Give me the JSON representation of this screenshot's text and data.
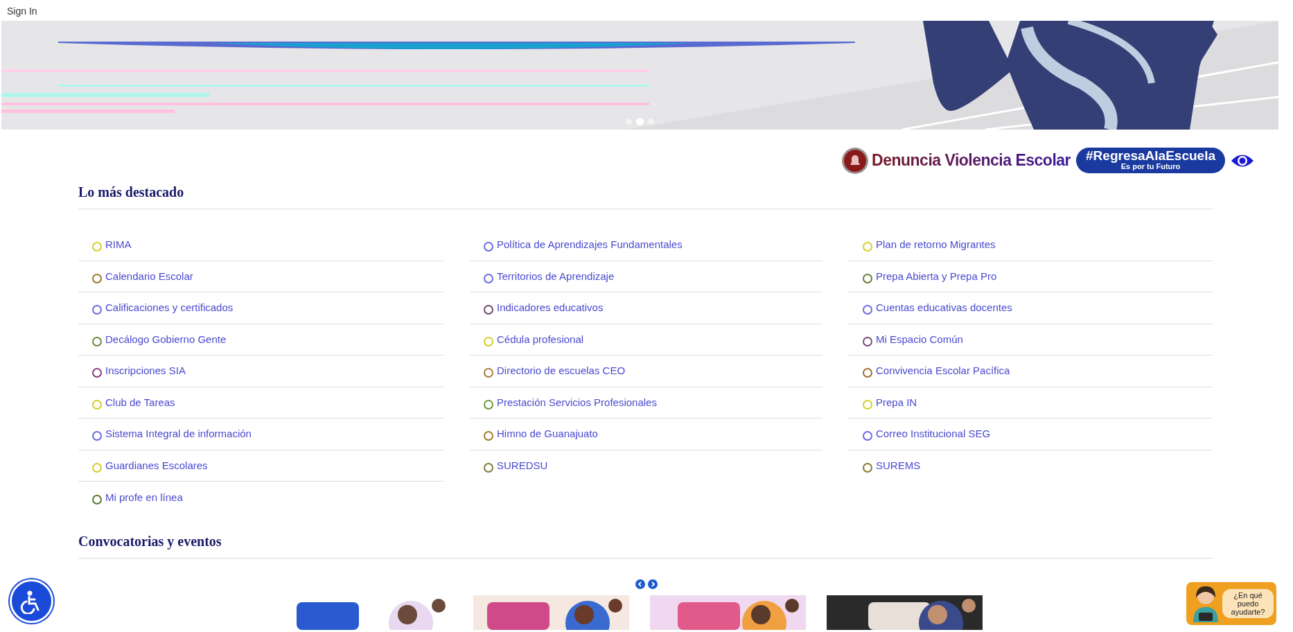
{
  "header": {
    "sign_in": "Sign In"
  },
  "banner": {
    "kind": "picture",
    "dots": [
      {
        "selected": false
      },
      {
        "selected": true
      },
      {
        "selected": false
      }
    ]
  },
  "quick_links": [
    {
      "kind": "alert",
      "label": "Denuncia Violencia Escolar"
    },
    {
      "kind": "pill",
      "label": "#RegresaAlaEscuela",
      "sublabel": "Es por tu Futuro"
    }
  ],
  "highlights": {
    "title": "Lo más destacado",
    "columns": [
      [
        {
          "label": "RIMA",
          "color": "#d4cf2a"
        },
        {
          "label": "Calendario Escolar",
          "color": "#9a7a2a"
        },
        {
          "label": "Calificaciones y certificados",
          "color": "#6a6ae0"
        },
        {
          "label": "Decálogo Gobierno Gente",
          "color": "#6a8a3a"
        },
        {
          "label": "Inscripciones SIA",
          "color": "#8a3a7a"
        },
        {
          "label": "Club de Tareas",
          "color": "#d4cf2a"
        },
        {
          "label": "Sistema Integral de información",
          "color": "#6a6ae0"
        },
        {
          "label": "Guardianes Escolares",
          "color": "#d4cf2a"
        },
        {
          "label": "Mi profe en línea",
          "color": "#5a7a2a"
        }
      ],
      [
        {
          "label": "Política de Aprendizajes Fundamentales",
          "color": "#6a6ae0"
        },
        {
          "label": "Territorios de Aprendizaje",
          "color": "#6a6ae0"
        },
        {
          "label": "Indicadores educativos",
          "color": "#6a4a6a"
        },
        {
          "label": "Cédula profesional",
          "color": "#d4cf2a"
        },
        {
          "label": "Directorio de escuelas CEO",
          "color": "#b07a3a"
        },
        {
          "label": "Prestación Servicios Profesionales",
          "color": "#6a9a3a"
        },
        {
          "label": "Himno de Guanajuato",
          "color": "#a07a2a"
        },
        {
          "label": "SUREDSU",
          "color": "#7a7a3a"
        }
      ],
      [
        {
          "label": "Plan de retorno Migrantes",
          "color": "#d4cf2a"
        },
        {
          "label": "Prepa Abierta y Prepa Pro",
          "color": "#6a7a3a"
        },
        {
          "label": "Cuentas educativas docentes",
          "color": "#6a6ae0"
        },
        {
          "label": "Mi Espacio Común",
          "color": "#7a4a7a"
        },
        {
          "label": "Convivencia Escolar Pacífica",
          "color": "#a0702a"
        },
        {
          "label": "Prepa IN",
          "color": "#d4cf2a"
        },
        {
          "label": "Correo Institucional SEG",
          "color": "#6a6ae0"
        },
        {
          "label": "SUREMS",
          "color": "#8a7a2a"
        }
      ]
    ]
  },
  "events": {
    "title": "Convocatorias y eventos"
  },
  "chat_widget": {
    "label": "¿En qué puedo ayudarte?"
  }
}
